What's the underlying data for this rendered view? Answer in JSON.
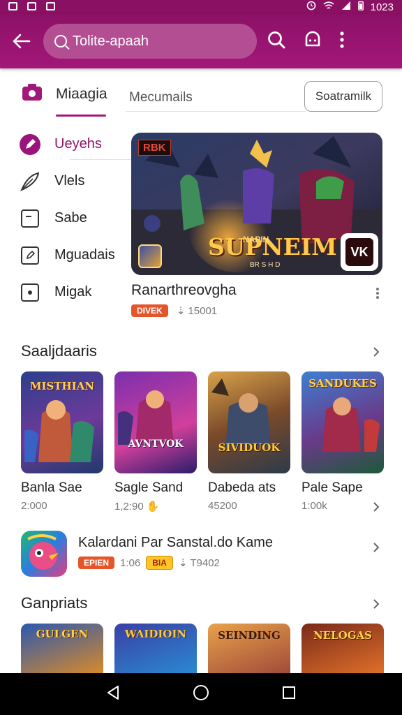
{
  "status_bar": {
    "time": "1023"
  },
  "app_bar": {
    "search_text": "Tolite-apaah",
    "icons": [
      "back-arrow-icon",
      "search-icon",
      "notification-icon",
      "more-vert-icon"
    ]
  },
  "tabs": {
    "main_label": "Miaagia",
    "second_label": "Mecumails",
    "chip_label": "Soatramilk"
  },
  "sidebar": {
    "items": [
      {
        "label": "Ueyehs",
        "icon": "circle-pen-icon"
      },
      {
        "label": "Vlels",
        "icon": "feather-icon"
      },
      {
        "label": "Sabe",
        "icon": "square-note-icon"
      },
      {
        "label": "Mguadais",
        "icon": "edit-square-icon"
      },
      {
        "label": "Migak",
        "icon": "square-dot-icon"
      }
    ]
  },
  "featured": {
    "badge": "RBK",
    "banner_title": "SUPNEIM",
    "banner_pre": "NAPIN",
    "banner_sub": "BR S H D",
    "logo_text": "VK",
    "name": "Ranarthreovgha",
    "tag": "DIVEK",
    "meta": "⇣ 15001"
  },
  "section1": {
    "title": "Saaljdaaris",
    "cards": [
      {
        "title": "Banla Sae",
        "sub": "2:000",
        "thumb_text": "MISTHIAN"
      },
      {
        "title": "Sagle Sand",
        "sub": "1,2:90",
        "thumb_text": "AVNTVOK"
      },
      {
        "title": "Dabeda ats",
        "sub": "45200",
        "thumb_text": "SIVIDUOK"
      },
      {
        "title": "Pale Sape",
        "sub": "1:00k",
        "thumb_text": "SANDUKES"
      }
    ]
  },
  "app_row": {
    "title": "Kalardani Par Sanstal.do Kame",
    "tag": "EPIEN",
    "rating": "1:06",
    "tag2": "BIA",
    "downloads": "⇣ T9402"
  },
  "section2": {
    "title": "Ganpriats",
    "cards": [
      {
        "thumb_text": "GULGEN"
      },
      {
        "thumb_text": "WAIDIOIN"
      },
      {
        "thumb_text": "SEINDING"
      },
      {
        "thumb_text": "NELOGAS"
      }
    ]
  },
  "colors": {
    "brand": "#8c1166",
    "accent_orange": "#e4562a",
    "accent_yellow": "#ffc52a"
  }
}
